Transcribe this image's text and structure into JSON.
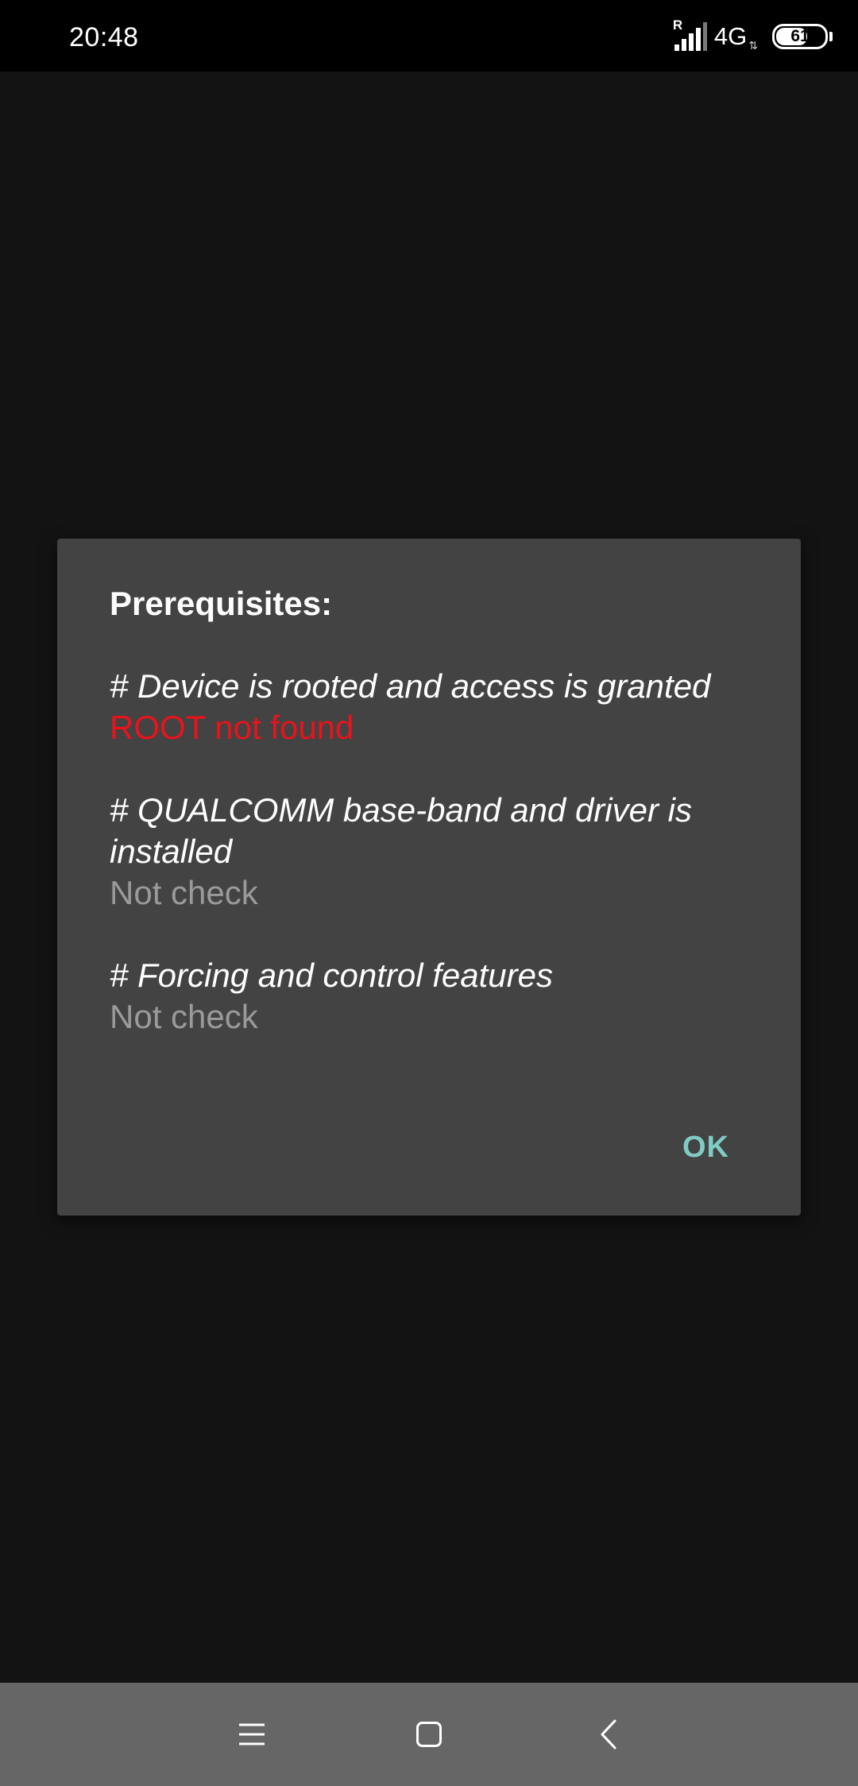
{
  "status_bar": {
    "time": "20:48",
    "roaming_indicator": "R",
    "signal_icon": "cellular-signal-icon",
    "network_type": "4G",
    "data_activity_icon": "data-arrows-icon",
    "battery_level": "61",
    "battery_fraction": 0.61
  },
  "dialog": {
    "title": "Prerequisites:",
    "requirements": [
      {
        "label": "# Device is rooted and access is granted",
        "status": "ROOT not found",
        "status_color": "#e8131b"
      },
      {
        "label": "# QUALCOMM base-band and driver is installed",
        "status": "Not check",
        "status_color": "#9a9a9a"
      },
      {
        "label": "# Forcing and control features",
        "status": "Not check",
        "status_color": "#9a9a9a"
      }
    ],
    "ok_label": "OK",
    "ok_color": "#80cbc4"
  },
  "nav_bar": {
    "menu_icon": "menu-icon",
    "home_icon": "home-icon",
    "back_icon": "back-icon"
  },
  "colors": {
    "background": "#131313",
    "dialog": "#434343",
    "nav_bar": "#666666"
  }
}
